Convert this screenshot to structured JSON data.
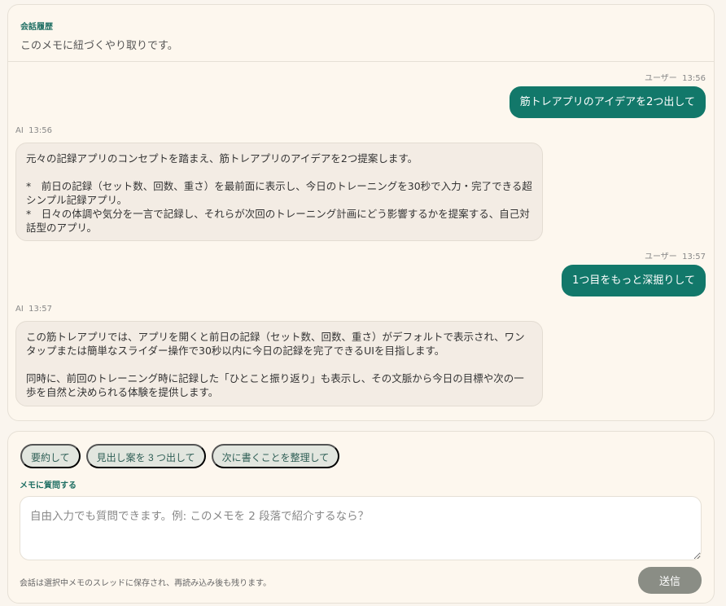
{
  "history": {
    "label": "会話履歴",
    "subtitle": "このメモに紐づくやり取りです。",
    "messages": [
      {
        "role": "ユーザー",
        "time": "13:56",
        "text": "筋トレアプリのアイデアを2つ出して"
      },
      {
        "role": "AI",
        "time": "13:56",
        "text": "元々の記録アプリのコンセプトを踏まえ、筋トレアプリのアイデアを2つ提案します。\n\n*　前日の記録（セット数、回数、重さ）を最前面に表示し、今日のトレーニングを30秒で入力・完了できる超シンプル記録アプリ。\n*　日々の体調や気分を一言で記録し、それらが次回のトレーニング計画にどう影響するかを提案する、自己対話型のアプリ。"
      },
      {
        "role": "ユーザー",
        "time": "13:57",
        "text": "1つ目をもっと深掘りして"
      },
      {
        "role": "AI",
        "time": "13:57",
        "text": "この筋トレアプリでは、アプリを開くと前日の記録（セット数、回数、重さ）がデフォルトで表示され、ワンタップまたは簡単なスライダー操作で30秒以内に今日の記録を完了できるUIを目指します。\n\n同時に、前回のトレーニング時に記録した「ひとこと振り返り」も表示し、その文脈から今日の目標や次の一歩を自然と決められる体験を提供します。"
      }
    ]
  },
  "composer": {
    "chips": [
      "要約して",
      "見出し案を 3 つ出して",
      "次に書くことを整理して"
    ],
    "label": "メモに質問する",
    "placeholder": "自由入力でも質問できます。例: このメモを 2 段落で紹介するなら？",
    "note": "会話は選択中メモのスレッドに保存され、再読み込み後も残ります。",
    "send": "送信"
  }
}
